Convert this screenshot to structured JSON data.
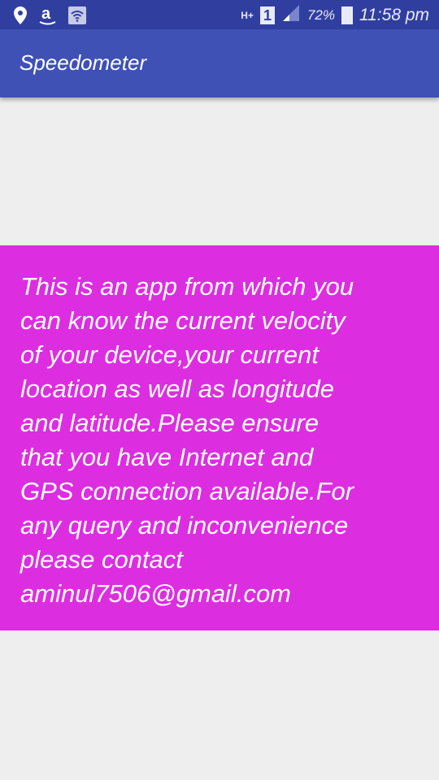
{
  "status_bar": {
    "icons": [
      "location-pin-icon",
      "amazon-icon",
      "wifi-icon",
      "h-plus-data-icon",
      "sim-1-icon",
      "signal-icon",
      "battery-icon"
    ],
    "network": "H+",
    "sim": "1",
    "battery": "72%",
    "time": "11:58 pm"
  },
  "app_bar": {
    "title": "Speedometer",
    "color": "#3f51b5"
  },
  "card": {
    "background": "#dc2ee0",
    "lines": [
      "This is an app from which you",
      "can know the current velocity",
      "of your device,your current",
      "location as well as longitude",
      "and latitude.Please ensure",
      "that you have Internet and",
      "GPS connection available.For",
      "any query and inconvenience",
      "please contact",
      "aminul7506@gmail.com"
    ]
  }
}
